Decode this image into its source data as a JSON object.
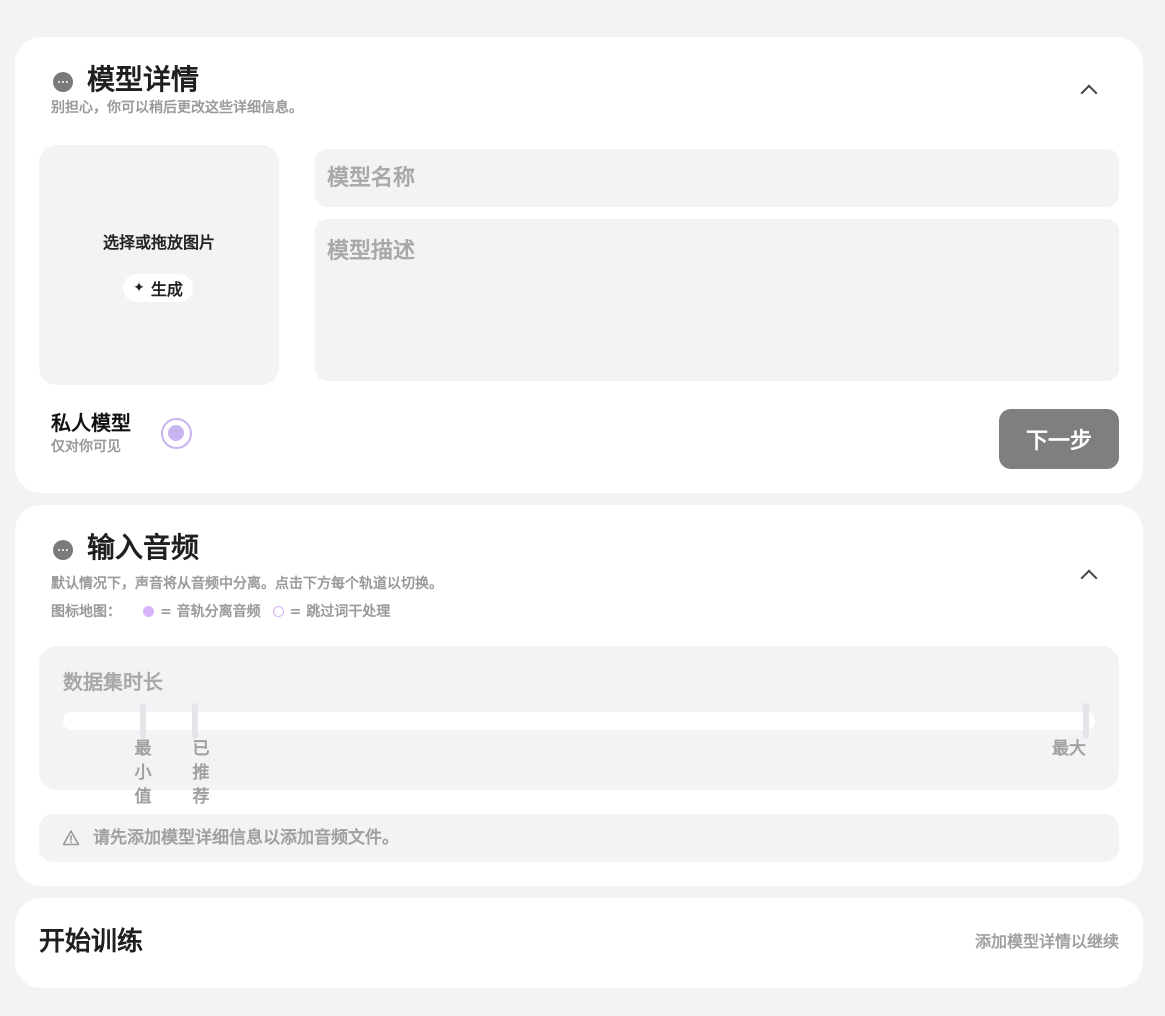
{
  "model_details": {
    "title": "模型详情",
    "subtitle": "别担心，你可以稍后更改这些详细信息。",
    "image_drop_label": "选择或拖放图片",
    "generate_label": "生成",
    "name_placeholder": "模型名称",
    "description_placeholder": "模型描述",
    "private_title": "私人模型",
    "private_subtitle": "仅对你可见",
    "private_checked": true,
    "next_label": "下一步"
  },
  "input_audio": {
    "title": "输入音频",
    "subtitle": "默认情况下，声音将从音频中分离。点击下方每个轨道以切换。",
    "legend_label": "图标地图：",
    "legend_filled": "= 音轨分离音频",
    "legend_hollow": "= 跳过词干处理",
    "duration_title": "数据集时长",
    "ticks": {
      "min": "最小值",
      "recommended": "已推荐",
      "max": "最大"
    },
    "warning": "请先添加模型详细信息以添加音频文件。"
  },
  "start_training": {
    "title": "开始训练",
    "hint": "添加模型详情以继续"
  },
  "colors": {
    "accent_purple": "#c8b4f0",
    "legend_purple": "#d6b4f7",
    "next_button": "#7f7f7f"
  },
  "icons": {
    "section": "ellipsis-circle-icon",
    "collapse": "chevron-up-icon",
    "generate": "sparkle-icon",
    "warning": "warning-triangle-icon"
  }
}
